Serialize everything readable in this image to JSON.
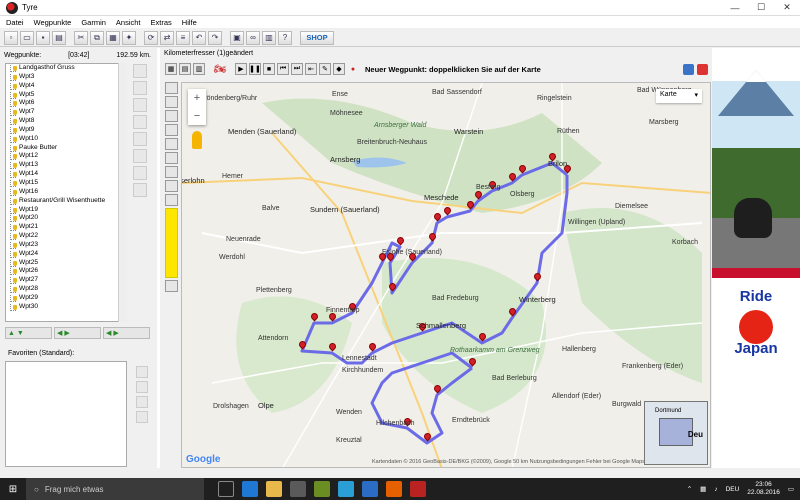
{
  "window": {
    "title": "Tyre",
    "minimize": "—",
    "maximize": "☐",
    "close": "✕"
  },
  "menu": [
    "Datei",
    "Wegpunkte",
    "Garmin",
    "Ansicht",
    "Extras",
    "Hilfe"
  ],
  "toolbar": {
    "shop_label": "SHOP"
  },
  "waypoints": {
    "label": "Wegpunkte:",
    "duration": "[03:42]",
    "distance": "192.59 km.",
    "items": [
      "Landgasthof Gruss",
      "Wpt3",
      "Wpt4",
      "Wpt5",
      "Wpt6",
      "Wpt7",
      "Wpt8",
      "Wpt9",
      "Wpt10",
      "Pauke Butter",
      "Wpt12",
      "Wpt13",
      "Wpt14",
      "Wpt15",
      "Wpt16",
      "Restaurant/Grill Wisenthuette",
      "Wpt19",
      "Wpt20",
      "Wpt21",
      "Wpt22",
      "Wpt23",
      "Wpt24",
      "Wpt25",
      "Wpt26",
      "Wpt27",
      "Wpt28",
      "Wpt29",
      "Wpt30"
    ]
  },
  "favorites": {
    "label": "Favoriten (Standard):"
  },
  "map": {
    "tab_title": "Kilometerfresser (1)geändert",
    "hint": "Neuer Wegpunkt: doppelklicken Sie auf der Karte",
    "map_type": "Karte",
    "zoom_in": "+",
    "zoom_out": "−",
    "google": "Google",
    "attribution": "Kartendaten © 2016 GeoBasis-DE/BKG (©2009), Google   50 km   Nutzungsbedingungen   Fehler bei Google Maps melden",
    "minimap_city": "Dortmund",
    "minimap_country": "Deu",
    "route_color": "#6b6be8",
    "pin_color": "#d2202a",
    "places": [
      {
        "name": "Fröndenberg/Ruhr"
      },
      {
        "name": "Ense"
      },
      {
        "name": "Bad Sassendorf"
      },
      {
        "name": "Ringelstein"
      },
      {
        "name": "Bad Wünnenberg"
      },
      {
        "name": "Menden (Sauerland)"
      },
      {
        "name": "Möhnesee"
      },
      {
        "name": "Warstein"
      },
      {
        "name": "Rüthen"
      },
      {
        "name": "Marsberg"
      },
      {
        "name": "Arnsberger Wald"
      },
      {
        "name": "Breitenbruch-Neuhaus"
      },
      {
        "name": "Arnsberg"
      },
      {
        "name": "Brilon"
      },
      {
        "name": "Iserlohn"
      },
      {
        "name": "Hemer"
      },
      {
        "name": "Meschede"
      },
      {
        "name": "Bestwig"
      },
      {
        "name": "Olsberg"
      },
      {
        "name": "Balve"
      },
      {
        "name": "Sundern (Sauerland)"
      },
      {
        "name": "Willingen (Upland)"
      },
      {
        "name": "Diemelsee"
      },
      {
        "name": "Neuenrade"
      },
      {
        "name": "Eslohe (Sauerland)"
      },
      {
        "name": "Korbach"
      },
      {
        "name": "Werdohl"
      },
      {
        "name": "Plettenberg"
      },
      {
        "name": "Winterberg"
      },
      {
        "name": "Bad Fredeburg"
      },
      {
        "name": "Finnentrop"
      },
      {
        "name": "Schmallenberg"
      },
      {
        "name": "Attendorn"
      },
      {
        "name": "Lennestadt"
      },
      {
        "name": "Rothaarkamm am Grenzweg"
      },
      {
        "name": "Hallenberg"
      },
      {
        "name": "Kirchhundem"
      },
      {
        "name": "Frankenberg (Eder)"
      },
      {
        "name": "Bad Berleburg"
      },
      {
        "name": "Olpe"
      },
      {
        "name": "Drolshagen"
      },
      {
        "name": "Wenden"
      },
      {
        "name": "Hilchenbach"
      },
      {
        "name": "Kreuztal"
      },
      {
        "name": "Erndtebrück"
      },
      {
        "name": "Allendorf (Eder)"
      },
      {
        "name": "Burgwald"
      }
    ]
  },
  "taskbar": {
    "search_placeholder": "Frag mich etwas",
    "language": "DEU",
    "time": "23:06",
    "date": "22.08.2016"
  },
  "ad": {
    "line1": "Ride",
    "line2": "Japan"
  }
}
